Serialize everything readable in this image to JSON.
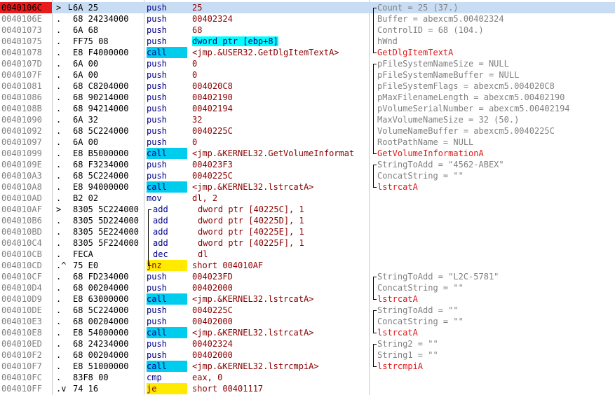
{
  "rows": [
    {
      "addr": "0040106C",
      "mk": ">",
      "hex": "6A 25",
      "mn": "push",
      "op": "25",
      "cm": "Count = 25 (37.)",
      "sel": true
    },
    {
      "addr": "0040106E",
      "mk": ".",
      "hex": "68 24234000",
      "mn": "push",
      "op": "00402324",
      "cm": "Buffer = abexcm5.00402324"
    },
    {
      "addr": "00401073",
      "mk": ".",
      "hex": "6A 68",
      "mn": "push",
      "op": "68",
      "cm": "ControlID = 68 (104.)"
    },
    {
      "addr": "00401075",
      "mk": ".",
      "hex": "FF75 08",
      "mn": "push",
      "op": "dword ptr [ebp+8]",
      "cm": "hWnd",
      "hlop": true
    },
    {
      "addr": "00401078",
      "mk": ".",
      "hex": "E8 F4000000",
      "mn": "call",
      "op": "<jmp.&USER32.GetDlgItemTextA>",
      "cm": "GetDlgItemTextA",
      "call": true,
      "fn": true
    },
    {
      "addr": "0040107D",
      "mk": ".",
      "hex": "6A 00",
      "mn": "push",
      "op": "0",
      "cm": "pFileSystemNameSize = NULL"
    },
    {
      "addr": "0040107F",
      "mk": ".",
      "hex": "6A 00",
      "mn": "push",
      "op": "0",
      "cm": "pFileSystemNameBuffer = NULL"
    },
    {
      "addr": "00401081",
      "mk": ".",
      "hex": "68 C8204000",
      "mn": "push",
      "op": "004020C8",
      "cm": "pFileSystemFlags = abexcm5.004020C8"
    },
    {
      "addr": "00401086",
      "mk": ".",
      "hex": "68 90214000",
      "mn": "push",
      "op": "00402190",
      "cm": "pMaxFilenameLength = abexcm5.00402190"
    },
    {
      "addr": "0040108B",
      "mk": ".",
      "hex": "68 94214000",
      "mn": "push",
      "op": "00402194",
      "cm": "pVolumeSerialNumber = abexcm5.00402194"
    },
    {
      "addr": "00401090",
      "mk": ".",
      "hex": "6A 32",
      "mn": "push",
      "op": "32",
      "cm": "MaxVolumeNameSize = 32 (50.)"
    },
    {
      "addr": "00401092",
      "mk": ".",
      "hex": "68 5C224000",
      "mn": "push",
      "op": "0040225C",
      "cm": "VolumeNameBuffer = abexcm5.0040225C"
    },
    {
      "addr": "00401097",
      "mk": ".",
      "hex": "6A 00",
      "mn": "push",
      "op": "0",
      "cm": "RootPathName = NULL"
    },
    {
      "addr": "00401099",
      "mk": ".",
      "hex": "E8 B5000000",
      "mn": "call",
      "op": "<jmp.&KERNEL32.GetVolumeInformat",
      "cm": "GetVolumeInformationA",
      "call": true,
      "fn": true
    },
    {
      "addr": "0040109E",
      "mk": ".",
      "hex": "68 F3234000",
      "mn": "push",
      "op": "004023F3",
      "cm": "StringToAdd = \"4562-ABEX\""
    },
    {
      "addr": "004010A3",
      "mk": ".",
      "hex": "68 5C224000",
      "mn": "push",
      "op": "0040225C",
      "cm": "ConcatString = \"\""
    },
    {
      "addr": "004010A8",
      "mk": ".",
      "hex": "E8 94000000",
      "mn": "call",
      "op": "<jmp.&KERNEL32.lstrcatA>",
      "cm": "lstrcatA",
      "call": true,
      "fn": true
    },
    {
      "addr": "004010AD",
      "mk": ".",
      "hex": "B2 02",
      "mn": "mov",
      "op": "dl, 2",
      "cm": ""
    },
    {
      "addr": "004010AF",
      "mk": ">",
      "hex": "8305 5C224000",
      "mn": "add",
      "op": "dword ptr [40225C], 1",
      "cm": "",
      "loop": true
    },
    {
      "addr": "004010B6",
      "mk": ".",
      "hex": "8305 5D224000",
      "mn": "add",
      "op": "dword ptr [40225D], 1",
      "cm": "",
      "loop": true
    },
    {
      "addr": "004010BD",
      "mk": ".",
      "hex": "8305 5E224000",
      "mn": "add",
      "op": "dword ptr [40225E], 1",
      "cm": "",
      "loop": true
    },
    {
      "addr": "004010C4",
      "mk": ".",
      "hex": "8305 5F224000",
      "mn": "add",
      "op": "dword ptr [40225F], 1",
      "cm": "",
      "loop": true
    },
    {
      "addr": "004010CB",
      "mk": ".",
      "hex": "FECA",
      "mn": "dec",
      "op": "dl",
      "cm": "",
      "loop": true
    },
    {
      "addr": "004010CD",
      "mk": ".^",
      "hex": "75 E0",
      "mn": "jnz",
      "op": "short 004010AF",
      "cm": "",
      "jmp": true
    },
    {
      "addr": "004010CF",
      "mk": ".",
      "hex": "68 FD234000",
      "mn": "push",
      "op": "004023FD",
      "cm": "StringToAdd = \"L2C-5781\""
    },
    {
      "addr": "004010D4",
      "mk": ".",
      "hex": "68 00204000",
      "mn": "push",
      "op": "00402000",
      "cm": "ConcatString = \"\""
    },
    {
      "addr": "004010D9",
      "mk": ".",
      "hex": "E8 63000000",
      "mn": "call",
      "op": "<jmp.&KERNEL32.lstrcatA>",
      "cm": "lstrcatA",
      "call": true,
      "fn": true
    },
    {
      "addr": "004010DE",
      "mk": ".",
      "hex": "68 5C224000",
      "mn": "push",
      "op": "0040225C",
      "cm": "StringToAdd = \"\""
    },
    {
      "addr": "004010E3",
      "mk": ".",
      "hex": "68 00204000",
      "mn": "push",
      "op": "00402000",
      "cm": "ConcatString = \"\""
    },
    {
      "addr": "004010E8",
      "mk": ".",
      "hex": "E8 54000000",
      "mn": "call",
      "op": "<jmp.&KERNEL32.lstrcatA>",
      "cm": "lstrcatA",
      "call": true,
      "fn": true
    },
    {
      "addr": "004010ED",
      "mk": ".",
      "hex": "68 24234000",
      "mn": "push",
      "op": "00402324",
      "cm": "String2 = \"\""
    },
    {
      "addr": "004010F2",
      "mk": ".",
      "hex": "68 00204000",
      "mn": "push",
      "op": "00402000",
      "cm": "String1 = \"\""
    },
    {
      "addr": "004010F7",
      "mk": ".",
      "hex": "E8 51000000",
      "mn": "call",
      "op": "<jmp.&KERNEL32.lstrcmpiA>",
      "cm": "lstrcmpiA",
      "call": true,
      "fn": true
    },
    {
      "addr": "004010FC",
      "mk": ".",
      "hex": "83F8 00",
      "mn": "cmp",
      "op": "eax, 0",
      "cm": ""
    },
    {
      "addr": "004010FF",
      "mk": ".v",
      "hex": "74 16",
      "mn": "je",
      "op": "short 00401117",
      "cm": "",
      "jmp": true
    }
  ]
}
